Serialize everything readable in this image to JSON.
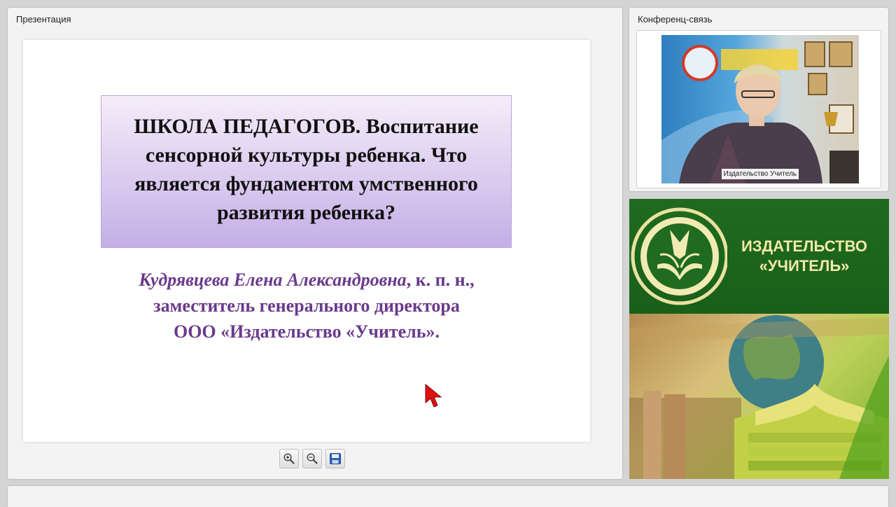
{
  "presentation": {
    "panel_title": "Презентация",
    "slide": {
      "title": "ШКОЛА ПЕДАГОГОВ. Воспитание сенсорной культуры ребенка. Что является фундаментом умственного развития ребенка?",
      "author_name": "Кудрявцева Елена Александровна",
      "author_degree": ", к. п. н.,",
      "author_position": "заместитель генерального директора",
      "author_org": "ООО «Издательство «Учитель»."
    },
    "toolbar": {
      "zoom_in": "zoom-in-icon",
      "zoom_out": "zoom-out-icon",
      "save": "save-icon"
    }
  },
  "conference": {
    "panel_title": "Конференц-связь",
    "video_label": "Издательство Учитель"
  },
  "banner": {
    "line1": "ИЗДАТЕЛЬСТВО",
    "line2": "«УЧИТЕЛЬ»"
  },
  "colors": {
    "title_box": "#d8c8ee",
    "author_text": "#6a3a8c",
    "banner_green": "#1f6b1f",
    "banner_text": "#f2e9a8",
    "cursor_red": "#e01010"
  }
}
